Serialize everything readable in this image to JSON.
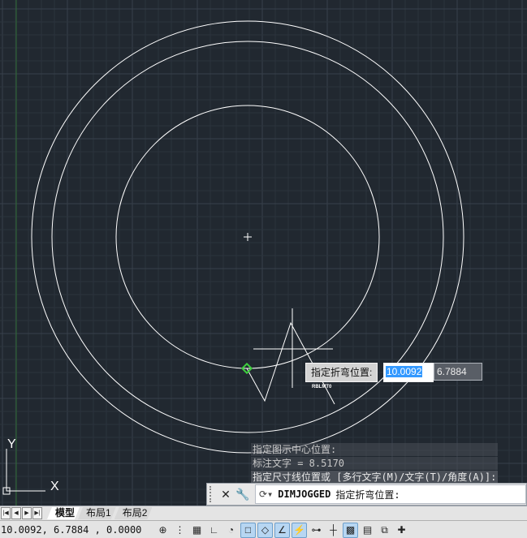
{
  "viewport": {
    "colors": {
      "background": "#212830",
      "grid_minor": "#2c333d",
      "grid_major": "#38404b",
      "geometry": "#ffffff",
      "y_axis_line": "#2e6b35",
      "snap_marker": "#3ecf3e"
    },
    "ucs": {
      "x_label": "X",
      "y_label": "Y"
    }
  },
  "dimension_prompt": {
    "label": "指定折弯位置:",
    "x_value": "10.0092",
    "y_value": "6.7884",
    "cursor_tag": "RBLMT0"
  },
  "command_history": {
    "lines": [
      "指定图示中心位置:",
      "标注文字 = 8.5170",
      "指定尺寸线位置或 [多行文字(M)/文字(T)/角度(A)]:"
    ]
  },
  "command_line": {
    "command": "DIMJOGGED",
    "prompt": "指定折弯位置:",
    "close_icon": "close-icon",
    "settings_icon": "wrench-icon"
  },
  "layout_tabs": {
    "tabs": [
      "模型",
      "布局1",
      "布局2"
    ],
    "active": "模型"
  },
  "status_bar": {
    "coordinates": "10.0092, 6.7884 , 0.0000",
    "icons": [
      "infer-constraints-icon",
      "snap-mode-icon",
      "grid-display-icon",
      "ortho-mode-icon",
      "polar-tracking-icon",
      "object-snap-icon",
      "3d-object-snap-icon",
      "object-snap-tracking-icon",
      "dynamic-ucs-icon",
      "dynamic-input-icon",
      "lineweight-icon",
      "transparency-icon",
      "quick-properties-icon",
      "selection-cycling-icon",
      "annotation-monitor-icon"
    ]
  }
}
